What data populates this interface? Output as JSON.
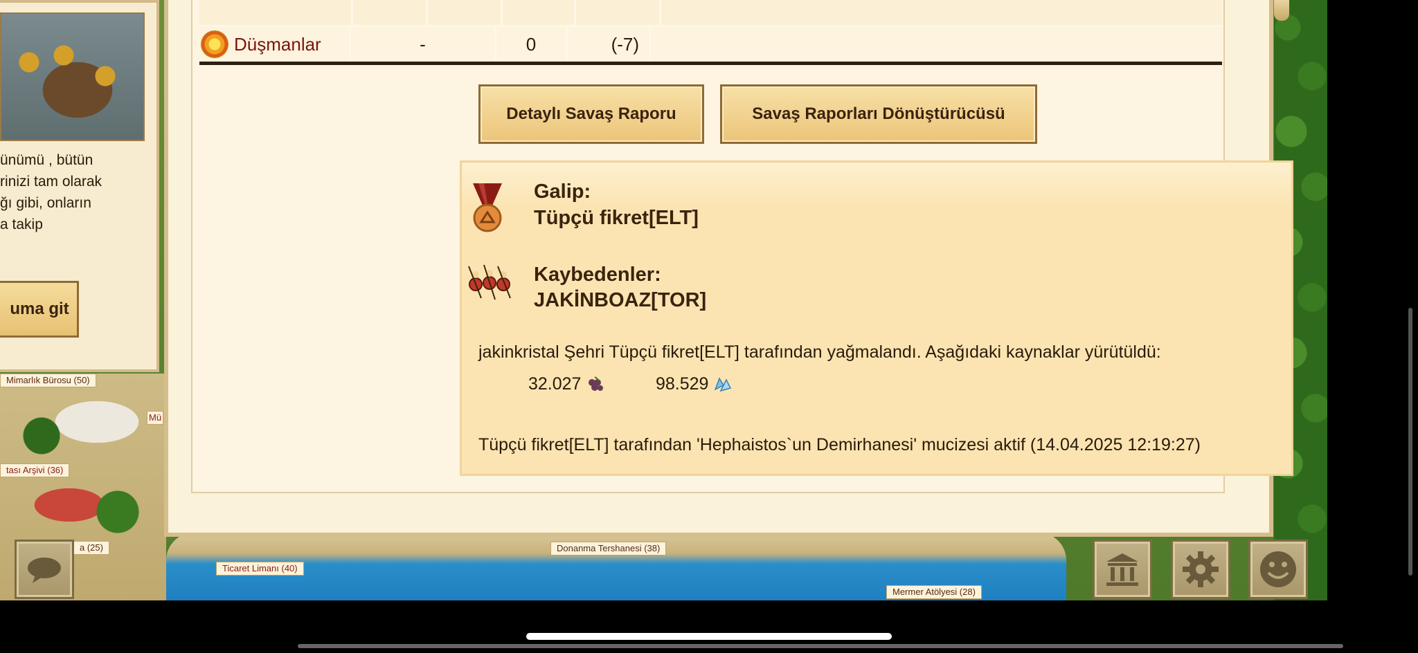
{
  "map": {
    "labels": {
      "architect_office": "Mimarlık Bürosu (50)",
      "mu_fragment": "Mü",
      "archive": "tası Arşivi (36)",
      "a25": "a (25)",
      "trade_port": "Ticaret Limanı (40)",
      "shipyard": "Donanma Tershanesi (38)",
      "marble_workshop": "Mermer Atölyesi (28)"
    }
  },
  "left_panel": {
    "description_lines": [
      "ünümü , bütün",
      "rinizi tam olarak",
      "ğı gibi, onların",
      "a takip"
    ],
    "go_button": "uma git"
  },
  "table": {
    "enemies_row": {
      "label": "Düşmanlar",
      "col2": "-",
      "col3": "0",
      "col4": "(-7)",
      "col5": ""
    }
  },
  "buttons": {
    "detailed_report": "Detaylı Savaş Raporu",
    "report_converter": "Savaş Raporları Dönüştürücüsü"
  },
  "result": {
    "winner_label": "Galip:",
    "winner_name": "Tüpçü fikret[ELT]",
    "losers_label": "Kaybedenler:",
    "loser_name": "JAKİNBOAZ[TOR]",
    "plunder_text": "jakinkristal Şehri Tüpçü fikret[ELT] tarafından yağmalandı. Aşağıdaki kaynaklar yürütüldü:",
    "resources": [
      {
        "amount": "32.027",
        "icon": "wine-icon"
      },
      {
        "amount": "98.529",
        "icon": "crystal-icon"
      }
    ],
    "wonder_text": "Tüpçü fikret[ELT] tarafından 'Hephaistos`un Demirhanesi' mucizesi aktif (14.04.2025 12:19:27)"
  },
  "bottom_ui": {
    "icons": [
      "chat-icon",
      "temple-icon",
      "gear-icon",
      "smiley-icon"
    ]
  },
  "colors": {
    "panel_bg": "#fbf2da",
    "button_gradient_top": "#f7e0a6",
    "button_gradient_bottom": "#ecc57a",
    "enemy_text": "#7a1410",
    "result_bg": "#fbe4b2"
  }
}
